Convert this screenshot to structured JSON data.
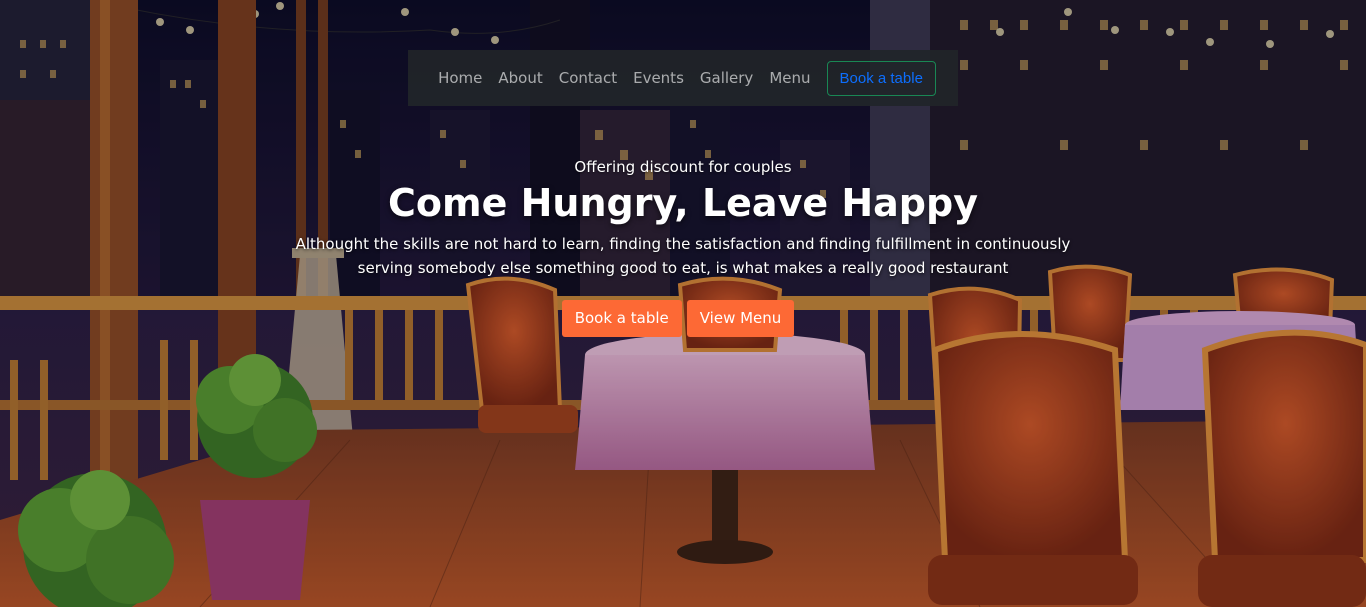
{
  "nav": {
    "links": [
      "Home",
      "About",
      "Contact",
      "Events",
      "Gallery",
      "Menu"
    ],
    "book_label": "Book a table"
  },
  "hero": {
    "tagline": "Offering discount for couples",
    "title": "Come Hungry, Leave Happy",
    "description": "Althought the skills are not hard to learn, finding the satisfaction and finding fulfillment in continuously serving somebody else something good to eat, is what makes a really good restaurant",
    "cta_primary": "Book a table",
    "cta_secondary": "View Menu"
  },
  "colors": {
    "accent": "#fd6935",
    "navbar_bg": "#212529",
    "nav_book_border": "#198754",
    "nav_book_text": "#0d6efd"
  }
}
